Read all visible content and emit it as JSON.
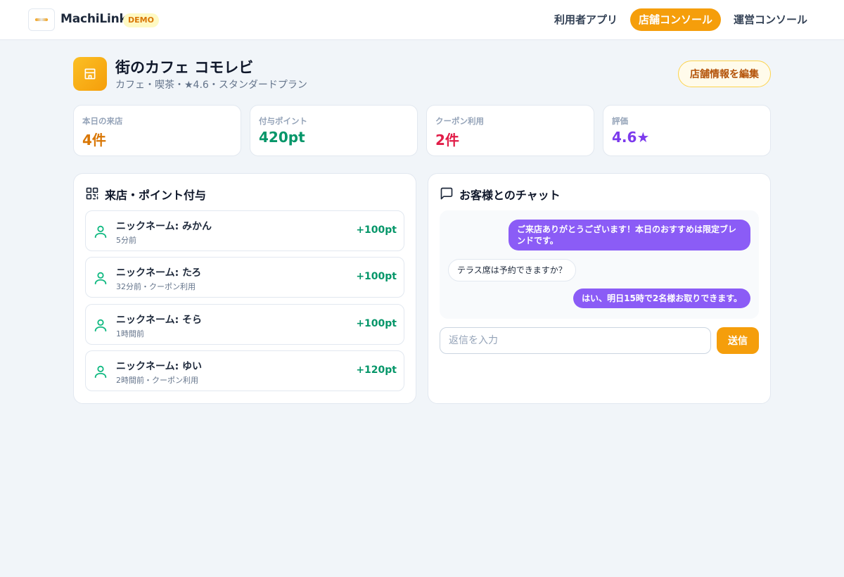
{
  "header": {
    "brand": "MachiLink",
    "badge": "DEMO",
    "nav": [
      {
        "label": "利用者アプリ",
        "active": false
      },
      {
        "label": "店舗コンソール",
        "active": true
      },
      {
        "label": "運営コンソール",
        "active": false
      }
    ]
  },
  "store": {
    "name": "街のカフェ コモレビ",
    "meta": "カフェ・喫茶・★4.6・スタンダードプラン",
    "edit_label": "店舗情報を編集"
  },
  "stats": [
    {
      "label": "本日の来店",
      "value": "4件",
      "color": "#d97706"
    },
    {
      "label": "付与ポイント",
      "value": "420pt",
      "color": "#059669"
    },
    {
      "label": "クーポン利用",
      "value": "2件",
      "color": "#e11d48"
    },
    {
      "label": "評価",
      "value": "4.6★",
      "color": "#7c3aed"
    }
  ],
  "visits": {
    "title": "来店・ポイント付与",
    "items": [
      {
        "name": "ニックネーム: みかん",
        "sub": "5分前",
        "points": "+100pt"
      },
      {
        "name": "ニックネーム: たろ",
        "sub": "32分前・クーポン利用",
        "points": "+100pt"
      },
      {
        "name": "ニックネーム: そら",
        "sub": "1時間前",
        "points": "+100pt"
      },
      {
        "name": "ニックネーム: ゆい",
        "sub": "2時間前・クーポン利用",
        "points": "+120pt"
      }
    ]
  },
  "chat": {
    "title": "お客様とのチャット",
    "messages": [
      {
        "from": "store",
        "text": "ご来店ありがとうございます！本日のおすすめは限定ブレンドです。"
      },
      {
        "from": "customer",
        "text": "テラス席は予約できますか？"
      },
      {
        "from": "store",
        "text": "はい、明日15時で2名様お取りできます。"
      }
    ],
    "placeholder": "返信を入力",
    "send_label": "送信"
  },
  "colors": {
    "accent": "#f59e0b",
    "chat_bubble": "#8b5cf6",
    "points": "#059669"
  }
}
